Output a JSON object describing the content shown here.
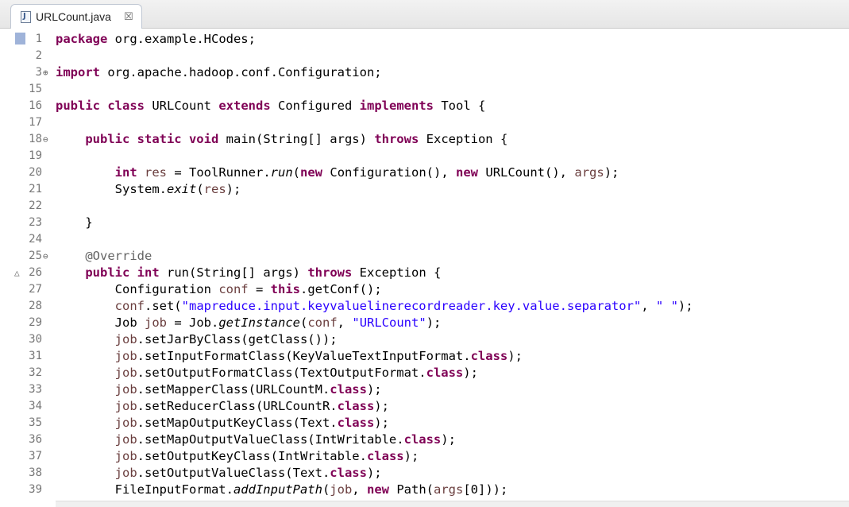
{
  "tab": {
    "title": "URLCount.java",
    "close": "☒"
  },
  "lines": [
    {
      "n": "1",
      "marker": "",
      "tokens": [
        [
          "kw",
          "package"
        ],
        [
          "",
          "org.example.HCodes;"
        ]
      ]
    },
    {
      "n": "2",
      "marker": "",
      "tokens": []
    },
    {
      "n": "3",
      "marker": "⊕",
      "tokens": [
        [
          "kw",
          "import"
        ],
        [
          "",
          "org.apache.hadoop.conf.Configuration;"
        ]
      ]
    },
    {
      "n": "15",
      "marker": "",
      "tokens": []
    },
    {
      "n": "16",
      "marker": "",
      "tokens": [
        [
          "kw",
          "public class"
        ],
        [
          "",
          "URLCount"
        ],
        [
          "kw",
          "extends"
        ],
        [
          "",
          "Configured"
        ],
        [
          "kw",
          "implements"
        ],
        [
          "",
          "Tool {"
        ]
      ]
    },
    {
      "n": "17",
      "marker": "",
      "tokens": []
    },
    {
      "n": "18",
      "marker": "⊖",
      "tokens": [
        [
          "",
          "    "
        ],
        [
          "kw",
          "public static void"
        ],
        [
          "",
          "main(String[] args)"
        ],
        [
          "kw",
          "throws"
        ],
        [
          "",
          "Exception {"
        ]
      ]
    },
    {
      "n": "19",
      "marker": "",
      "tokens": []
    },
    {
      "n": "20",
      "marker": "",
      "tokens": [
        [
          "",
          "        "
        ],
        [
          "kw",
          "int"
        ],
        [
          "var",
          "res"
        ],
        [
          "",
          "= ToolRunner."
        ],
        [
          "it",
          "run"
        ],
        [
          "",
          "("
        ],
        [
          "kw",
          "new"
        ],
        [
          "",
          "Configuration(),"
        ],
        [
          "kw",
          "new"
        ],
        [
          "",
          "URLCount(),"
        ],
        [
          "var",
          "args"
        ],
        [
          "",
          ");"
        ]
      ]
    },
    {
      "n": "21",
      "marker": "",
      "tokens": [
        [
          "",
          "        System."
        ],
        [
          "it",
          "exit"
        ],
        [
          "",
          "("
        ],
        [
          "var",
          "res"
        ],
        [
          "",
          ");"
        ]
      ]
    },
    {
      "n": "22",
      "marker": "",
      "tokens": []
    },
    {
      "n": "23",
      "marker": "",
      "tokens": [
        [
          "",
          "    }"
        ]
      ]
    },
    {
      "n": "24",
      "marker": "",
      "tokens": []
    },
    {
      "n": "25",
      "marker": "⊖",
      "tokens": [
        [
          "",
          "    "
        ],
        [
          "ann",
          "@Override"
        ]
      ]
    },
    {
      "n": "26",
      "marker": "△",
      "tokens": [
        [
          "",
          "    "
        ],
        [
          "kw",
          "public int"
        ],
        [
          "",
          "run(String[] args)"
        ],
        [
          "kw",
          "throws"
        ],
        [
          "",
          "Exception {"
        ]
      ]
    },
    {
      "n": "27",
      "marker": "",
      "tokens": [
        [
          "",
          "        Configuration"
        ],
        [
          "var",
          "conf"
        ],
        [
          "",
          "="
        ],
        [
          "kw",
          "this"
        ],
        [
          "",
          ".getConf();"
        ]
      ]
    },
    {
      "n": "28",
      "marker": "",
      "tokens": [
        [
          "",
          "        "
        ],
        [
          "var",
          "conf"
        ],
        [
          "",
          ".set("
        ],
        [
          "str",
          "\"mapreduce.input.keyvaluelinerecordreader.key.value.separator\""
        ],
        [
          "",
          ","
        ],
        [
          "str",
          "\" \""
        ],
        [
          "",
          ");"
        ]
      ]
    },
    {
      "n": "29",
      "marker": "",
      "tokens": [
        [
          "",
          "        Job"
        ],
        [
          "var",
          "job"
        ],
        [
          "",
          "= Job."
        ],
        [
          "it",
          "getInstance"
        ],
        [
          "",
          "("
        ],
        [
          "var",
          "conf"
        ],
        [
          "",
          ","
        ],
        [
          "str",
          "\"URLCount\""
        ],
        [
          "",
          ");"
        ]
      ]
    },
    {
      "n": "30",
      "marker": "",
      "tokens": [
        [
          "",
          "        "
        ],
        [
          "var",
          "job"
        ],
        [
          "",
          ".setJarByClass(getClass());"
        ]
      ]
    },
    {
      "n": "31",
      "marker": "",
      "tokens": [
        [
          "",
          "        "
        ],
        [
          "var",
          "job"
        ],
        [
          "",
          ".setInputFormatClass(KeyValueTextInputFormat."
        ],
        [
          "kw",
          "class"
        ],
        [
          "",
          ");"
        ]
      ]
    },
    {
      "n": "32",
      "marker": "",
      "tokens": [
        [
          "",
          "        "
        ],
        [
          "var",
          "job"
        ],
        [
          "",
          ".setOutputFormatClass(TextOutputFormat."
        ],
        [
          "kw",
          "class"
        ],
        [
          "",
          ");"
        ]
      ]
    },
    {
      "n": "33",
      "marker": "",
      "tokens": [
        [
          "",
          "        "
        ],
        [
          "var",
          "job"
        ],
        [
          "",
          ".setMapperClass(URLCountM."
        ],
        [
          "kw",
          "class"
        ],
        [
          "",
          ");"
        ]
      ]
    },
    {
      "n": "34",
      "marker": "",
      "tokens": [
        [
          "",
          "        "
        ],
        [
          "var",
          "job"
        ],
        [
          "",
          ".setReducerClass(URLCountR."
        ],
        [
          "kw",
          "class"
        ],
        [
          "",
          ");"
        ]
      ]
    },
    {
      "n": "35",
      "marker": "",
      "tokens": [
        [
          "",
          "        "
        ],
        [
          "var",
          "job"
        ],
        [
          "",
          ".setMapOutputKeyClass(Text."
        ],
        [
          "kw",
          "class"
        ],
        [
          "",
          ");"
        ]
      ]
    },
    {
      "n": "36",
      "marker": "",
      "tokens": [
        [
          "",
          "        "
        ],
        [
          "var",
          "job"
        ],
        [
          "",
          ".setMapOutputValueClass(IntWritable."
        ],
        [
          "kw",
          "class"
        ],
        [
          "",
          ");"
        ]
      ]
    },
    {
      "n": "37",
      "marker": "",
      "tokens": [
        [
          "",
          "        "
        ],
        [
          "var",
          "job"
        ],
        [
          "",
          ".setOutputKeyClass(IntWritable."
        ],
        [
          "kw",
          "class"
        ],
        [
          "",
          ");"
        ]
      ]
    },
    {
      "n": "38",
      "marker": "",
      "tokens": [
        [
          "",
          "        "
        ],
        [
          "var",
          "job"
        ],
        [
          "",
          ".setOutputValueClass(Text."
        ],
        [
          "kw",
          "class"
        ],
        [
          "",
          ");"
        ]
      ]
    },
    {
      "n": "39",
      "marker": "",
      "tokens": [
        [
          "",
          "        FileInputFormat."
        ],
        [
          "it",
          "addInputPath"
        ],
        [
          "",
          "("
        ],
        [
          "var",
          "job"
        ],
        [
          "",
          ","
        ],
        [
          "kw",
          "new"
        ],
        [
          "",
          "Path("
        ],
        [
          "var",
          "args"
        ],
        [
          "",
          "[0]));"
        ]
      ]
    }
  ]
}
